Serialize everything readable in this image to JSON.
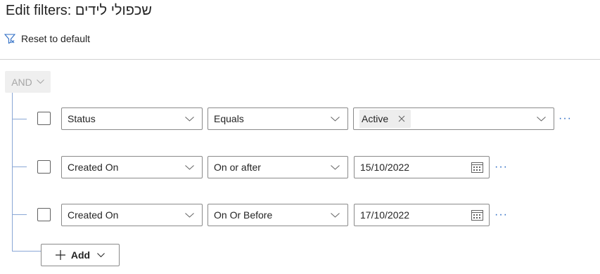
{
  "header": {
    "title": "Edit filters: שכפולי לידים",
    "reset_label": "Reset to default"
  },
  "group": {
    "operator": "AND"
  },
  "rows": [
    {
      "field": "Status",
      "operator": "Equals",
      "value_tag": "Active"
    },
    {
      "field": "Created On",
      "operator": "On or after",
      "date": "15/10/2022"
    },
    {
      "field": "Created On",
      "operator": "On Or Before",
      "date": "17/10/2022"
    }
  ],
  "footer": {
    "add_label": "Add"
  },
  "colors": {
    "tree_line": "#8aa7d6",
    "more_dots": "#2b6bc4",
    "disabled_text": "#a6a6a6"
  },
  "icons": {
    "reset": "filter-reset-icon",
    "chevron": "chevron-down-icon",
    "remove": "close-icon",
    "calendar": "calendar-icon",
    "more": "more-options-icon",
    "add": "plus-icon"
  }
}
